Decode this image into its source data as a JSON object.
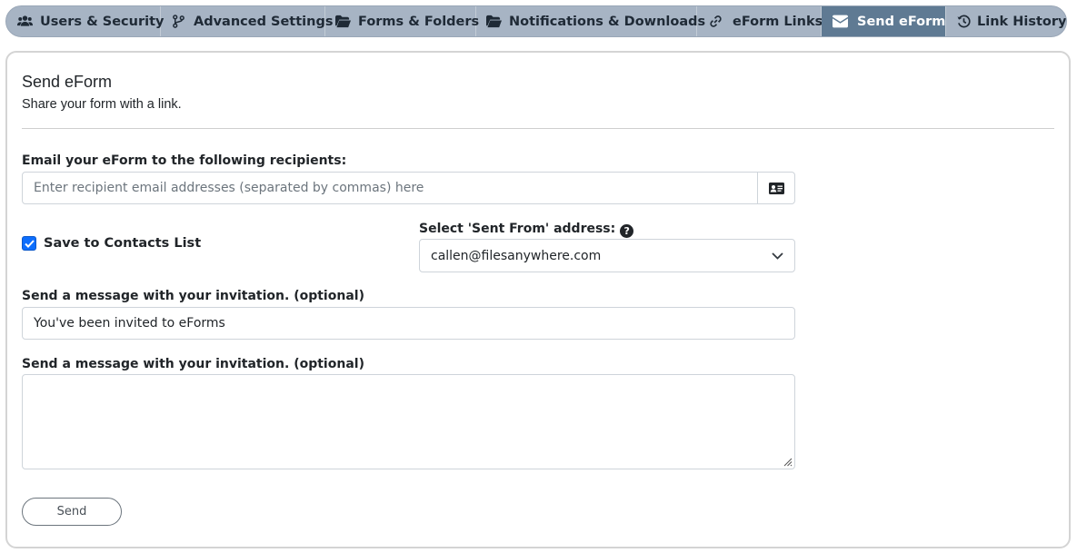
{
  "tabs": [
    {
      "label": "Users & Security",
      "icon": "users-icon",
      "active": false
    },
    {
      "label": "Advanced Settings",
      "icon": "code-branch-icon",
      "active": false
    },
    {
      "label": "Forms & Folders",
      "icon": "folder-open-icon",
      "active": false
    },
    {
      "label": "Notifications & Downloads",
      "icon": "folder-open-icon",
      "active": false
    },
    {
      "label": "eForm Links",
      "icon": "link-icon",
      "active": false
    },
    {
      "label": "Send eForm",
      "icon": "envelope-icon",
      "active": true
    },
    {
      "label": "Link History",
      "icon": "history-icon",
      "active": false
    }
  ],
  "panel": {
    "title": "Send eForm",
    "subtitle": "Share your form with a link."
  },
  "recipients": {
    "label": "Email your eForm to the following recipients:",
    "placeholder": "Enter recipient email addresses (separated by commas) here",
    "value": "",
    "addon_icon": "address-card-icon"
  },
  "save_contacts": {
    "label": "Save to Contacts List",
    "checked": true
  },
  "sent_from": {
    "label": "Select 'Sent From' address:",
    "help_icon": "question-circle-icon",
    "selected": "callen@filesanywhere.com"
  },
  "subject": {
    "label": "Send a message with your invitation. (optional)",
    "value": "You've been invited to eForms"
  },
  "message": {
    "label": "Send a message with your invitation. (optional)",
    "value": ""
  },
  "send_button": "Send",
  "colors": {
    "tabbar_bg": "#a7b4c4",
    "active_tab_bg": "#5f7a93",
    "checkbox_accent": "#0d6efd"
  }
}
